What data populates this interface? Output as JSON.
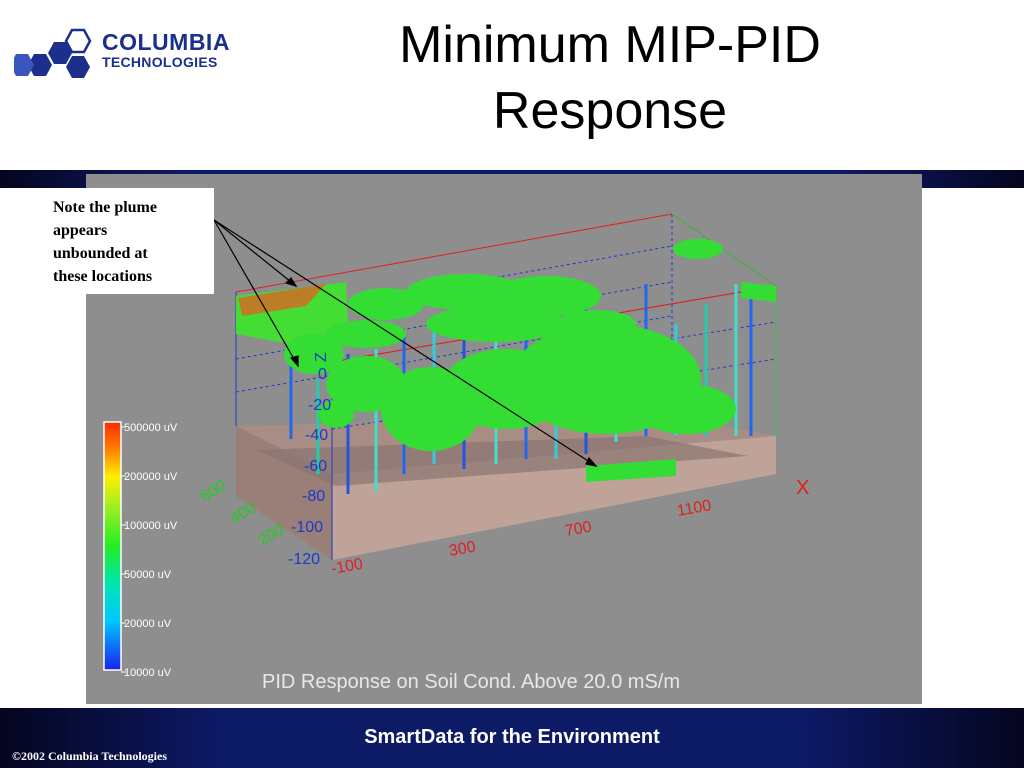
{
  "logo": {
    "line1": "COLUMBIA",
    "line2": "TECHNOLOGIES"
  },
  "slide": {
    "title_line1": "Minimum MIP-PID",
    "title_line2": "Response"
  },
  "note": [
    "Note the plume",
    "appears",
    "unbounded at",
    "these locations"
  ],
  "figure": {
    "caption": "PID Response on Soil Cond. Above 20.0 mS/m",
    "legend": [
      "500000 uV",
      "200000 uV",
      "100000 uV",
      "50000 uV",
      "20000 uV",
      "10000 uV"
    ],
    "z_ticks": [
      "0",
      "-20",
      "-40",
      "-60",
      "-80",
      "-100",
      "-120"
    ],
    "z_label": "Z",
    "x_ticks": [
      "-100",
      "300",
      "700",
      "1100"
    ],
    "x_label": "X",
    "y_ticks": [
      "200",
      "400",
      "600"
    ]
  },
  "footer": {
    "tagline": "SmartData for the Environment",
    "copyright": "©2002 Columbia Technologies"
  },
  "colors": {
    "navy": "#0d1a66",
    "figure_bg": "#8e8e8e",
    "plume": "#33dd33",
    "soil": "#b89a90",
    "axis_red": "#e02020",
    "axis_blue": "#1a3acc"
  }
}
